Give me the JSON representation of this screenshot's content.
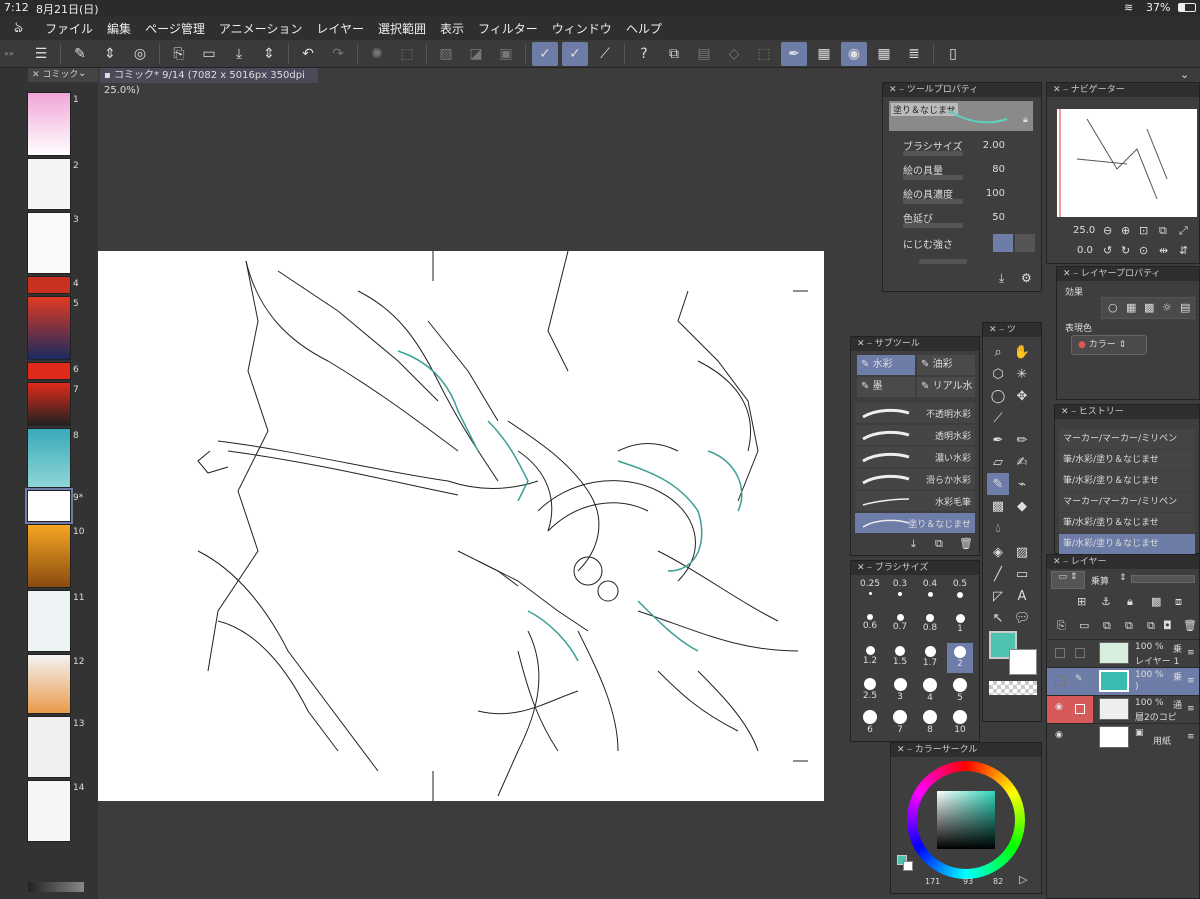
{
  "status": {
    "time": "7:12",
    "date": "8月21日(日)",
    "battery": "37%"
  },
  "menu": [
    "ファイル",
    "編集",
    "ページ管理",
    "アニメーション",
    "レイヤー",
    "選択範囲",
    "表示",
    "フィルター",
    "ウィンドウ",
    "ヘルプ"
  ],
  "page_tab": "コミック",
  "doc_tab": "コミック* 9/14 (7082 x 5016px 350dpi 25.0%)",
  "pages": [
    "1",
    "2",
    "3",
    "4",
    "5",
    "6",
    "7",
    "8",
    "9*",
    "10",
    "11",
    "12",
    "13",
    "14"
  ],
  "tool_property": {
    "title": "ツールプロパティ",
    "tool_name": "塗り＆なじませ",
    "brush_size_label": "ブラシサイズ",
    "brush_size": "2.00",
    "paint_amount_label": "絵の具量",
    "paint_amount": "80",
    "paint_density_label": "絵の具濃度",
    "paint_density": "100",
    "color_stretch_label": "色延び",
    "color_stretch": "50",
    "blur_label": "にじむ強さ"
  },
  "navigator": {
    "title": "ナビゲーター",
    "zoom": "25.0",
    "rotate": "0.0"
  },
  "layer_property": {
    "title": "レイヤープロパティ",
    "effect_label": "効果",
    "express_label": "表現色",
    "express_value": "カラー"
  },
  "history": {
    "title": "ヒストリー",
    "items": [
      "マーカー/マーカー/ミリペン",
      "筆/水彩/塗り＆なじませ",
      "筆/水彩/塗り＆なじませ",
      "マーカー/マーカー/ミリペン",
      "筆/水彩/塗り＆なじませ",
      "筆/水彩/塗り＆なじませ"
    ]
  },
  "subtool": {
    "title": "サブツール",
    "tabs": [
      "水彩",
      "油彩",
      "墨",
      "リアル水"
    ],
    "brushes": [
      "不透明水彩",
      "透明水彩",
      "濃い水彩",
      "滑らか水彩",
      "水彩毛筆",
      "塗り＆なじませ"
    ]
  },
  "tools_panel_title": "ツ",
  "brush_size_panel": {
    "title": "ブラシサイズ",
    "sizes": [
      "0.25",
      "0.3",
      "0.4",
      "0.5",
      "0.6",
      "0.7",
      "0.8",
      "1",
      "1.2",
      "1.5",
      "1.7",
      "2",
      "2.5",
      "3",
      "4",
      "5",
      "6",
      "7",
      "8",
      "10"
    ]
  },
  "layers": {
    "title": "レイヤー",
    "blend": "乗算",
    "items": [
      {
        "opacity": "100 %",
        "mode": "乗",
        "name": "レイヤー 1"
      },
      {
        "opacity": "100 %",
        "mode": "乗",
        "name": ")"
      },
      {
        "opacity": "100 %",
        "mode": "通",
        "name": "層2のコピ"
      },
      {
        "opacity": "",
        "mode": "",
        "name": "用紙"
      }
    ]
  },
  "color_circle": {
    "title": "カラーサークル",
    "h": "171",
    "s": "93",
    "v": "82",
    "main_color": "#4ec3b0"
  },
  "colors": {
    "accent": "#6e7da8"
  }
}
